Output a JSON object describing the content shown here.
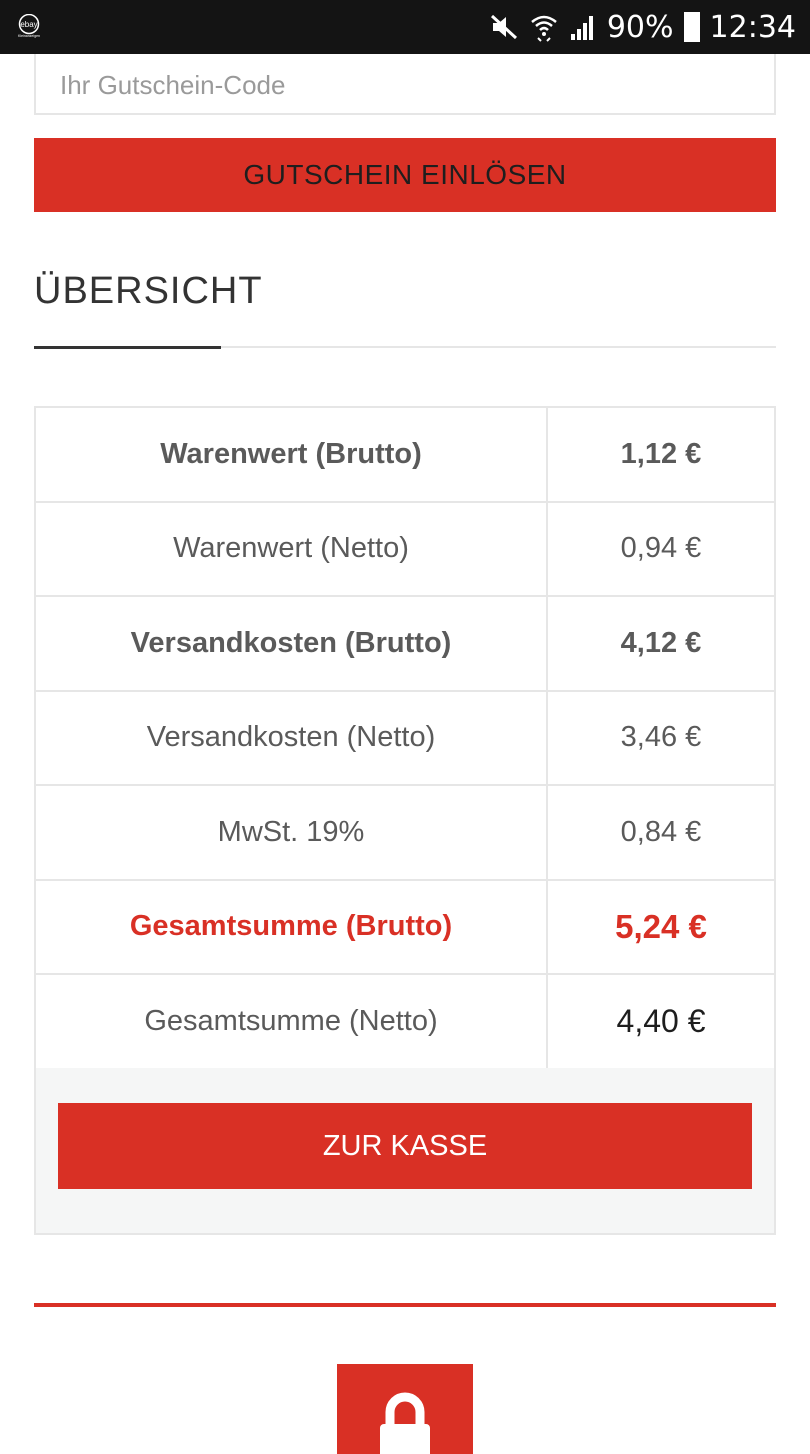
{
  "status_bar": {
    "logo_text": "ebay",
    "logo_subtext": "Kleinanzeigen",
    "battery_percent": "90%",
    "time": "12:34",
    "icons": [
      "mute-icon",
      "wifi-icon",
      "signal-icon",
      "battery-icon"
    ]
  },
  "coupon": {
    "placeholder": "Ihr Gutschein-Code",
    "button_label": "GUTSCHEIN EINLÖSEN"
  },
  "overview": {
    "title": "ÜBERSICHT",
    "rows": [
      {
        "label": "Warenwert (Brutto)",
        "value": "1,12 €"
      },
      {
        "label": "Warenwert (Netto)",
        "value": "0,94 €"
      },
      {
        "label": "Versandkosten (Brutto)",
        "value": "4,12 €"
      },
      {
        "label": "Versandkosten (Netto)",
        "value": "3,46 €"
      },
      {
        "label": "MwSt. 19%",
        "value": "0,84 €"
      },
      {
        "label": "Gesamtsumme (Brutto)",
        "value": "5,24 €"
      },
      {
        "label": "Gesamtsumme (Netto)",
        "value": "4,40 €"
      }
    ],
    "checkout_label": "ZUR KASSE"
  },
  "colors": {
    "accent": "#d93025",
    "status_bar": "#141414",
    "border": "#e6e6e6"
  },
  "bottom": {
    "icon": "lock-icon"
  }
}
